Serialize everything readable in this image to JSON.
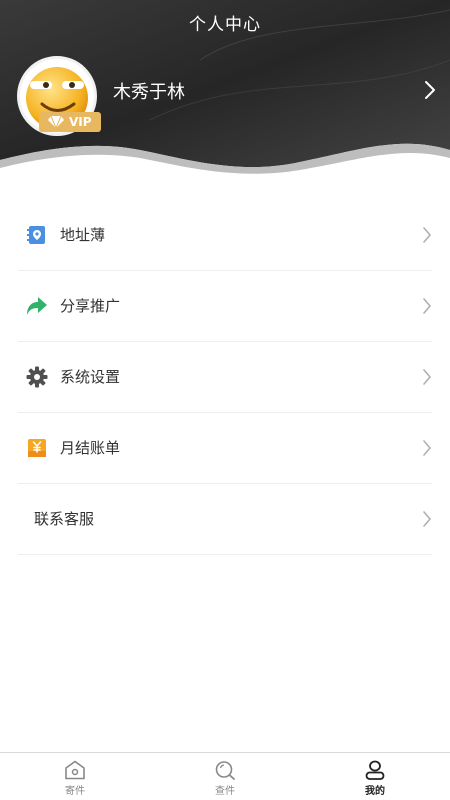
{
  "header": {
    "title": "个人中心",
    "username": "木秀于林",
    "vip_label": "VIP"
  },
  "menu": {
    "items": [
      {
        "label": "地址薄",
        "icon": "address-book-icon"
      },
      {
        "label": "分享推广",
        "icon": "share-arrow-icon"
      },
      {
        "label": "系统设置",
        "icon": "gear-icon"
      },
      {
        "label": "月结账单",
        "icon": "bill-yen-icon"
      },
      {
        "label": "联系客服",
        "icon": ""
      }
    ]
  },
  "tabbar": {
    "tabs": [
      {
        "label": "寄件",
        "icon": "home-icon",
        "active": false
      },
      {
        "label": "查件",
        "icon": "search-icon",
        "active": false
      },
      {
        "label": "我的",
        "icon": "user-icon",
        "active": true
      }
    ]
  },
  "colors": {
    "header_dark": "#2b2b2b",
    "vip_gold": "#e8b860",
    "share_green": "#2fb36a",
    "address_blue": "#4a8fe0",
    "bill_orange": "#f6a623"
  }
}
